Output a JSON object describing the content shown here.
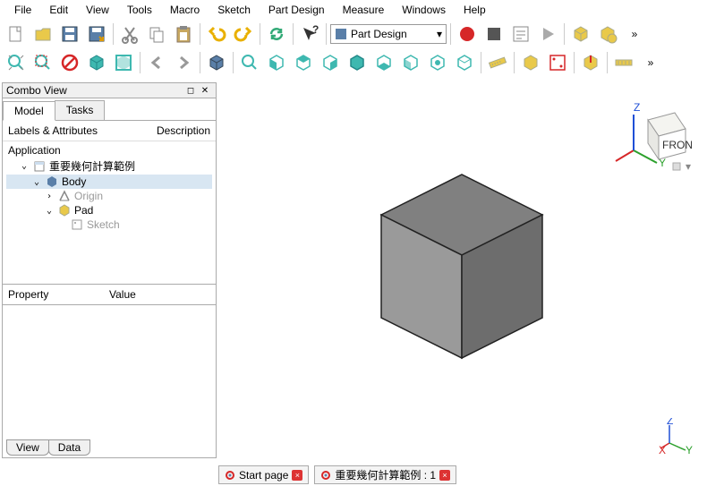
{
  "menu": {
    "items": [
      "File",
      "Edit",
      "View",
      "Tools",
      "Macro",
      "Sketch",
      "Part Design",
      "Measure",
      "Windows",
      "Help"
    ]
  },
  "workbench": {
    "name": "Part Design"
  },
  "combo": {
    "title": "Combo View",
    "tabs": [
      "Model",
      "Tasks"
    ],
    "active_tab": 0,
    "tree_headers": [
      "Labels & Attributes",
      "Description"
    ],
    "app_label": "Application",
    "nodes": {
      "doc": "重要幾何計算範例",
      "body": "Body",
      "origin": "Origin",
      "pad": "Pad",
      "sketch": "Sketch"
    },
    "prop_headers": [
      "Property",
      "Value"
    ],
    "bottom_tabs": [
      "View",
      "Data"
    ]
  },
  "doc_tabs": {
    "start": "Start page",
    "doc": "重要幾何計算範例 : 1"
  },
  "nav_cube": {
    "face": "FRONT",
    "axes": [
      "X",
      "Y",
      "Z"
    ]
  },
  "colors": {
    "cube_top": "#808080",
    "cube_front": "#9a9a9a",
    "cube_side": "#6d6d6d",
    "axis_x": "#d62728",
    "axis_y": "#2ca02c",
    "axis_z": "#1f4fd6",
    "yellow": "#e9c94a",
    "teal": "#3eb8b0",
    "red": "#d62728"
  }
}
